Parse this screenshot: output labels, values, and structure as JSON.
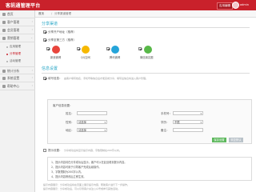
{
  "header": {
    "brand": "客訊通管理平台",
    "button_label": "应用编辑",
    "user_name": "admin",
    "accent": "#c9212b"
  },
  "sidebar": {
    "items": [
      {
        "label": "首页",
        "icon": "home-icon"
      },
      {
        "label": "客户管理",
        "icon": "users-icon"
      },
      {
        "label": "会员管理",
        "icon": "member-icon"
      },
      {
        "label": "营销管理",
        "icon": "marketing-icon"
      }
    ],
    "subitems": [
      {
        "label": "应用管理",
        "active": false
      },
      {
        "label": "分享管理",
        "active": true
      },
      {
        "label": "活动管理",
        "active": false
      }
    ],
    "items_bottom": [
      {
        "label": "统计分析",
        "icon": "chart-icon"
      },
      {
        "label": "系统设置",
        "icon": "settings-icon"
      },
      {
        "label": "帮助中心",
        "icon": "help-icon"
      }
    ]
  },
  "breadcrumb": {
    "home": "首页",
    "sep": "/",
    "current": "分享渠道管理"
  },
  "share_section": {
    "title": "分享渠道",
    "option1": "分享开户地址（推荐）",
    "option2": "分享至第三方（推荐）",
    "channels": [
      {
        "label": "新浪微博",
        "color": "#e8453c",
        "icon": "weibo-icon"
      },
      {
        "label": "QQ空间",
        "color": "#f6b800",
        "icon": "qzone-icon"
      },
      {
        "label": "腾讯微博",
        "color": "#25a4d9",
        "icon": "tencent-weibo-icon"
      },
      {
        "label": "微信朋友圈",
        "color": "#58b848",
        "icon": "wechat-icon"
      }
    ]
  },
  "info_section": {
    "title": "信息设置",
    "option1_label": "填写信息：",
    "option1_hint": "由客户填写姓名、手机号等信息后才能完成分享，填写后信息将进入客户管理。",
    "panel_title": "客户信息设置：",
    "fields": [
      {
        "label": "姓名：",
        "value": ""
      },
      {
        "label": "手机号：",
        "value": ""
      },
      {
        "label": "性别：",
        "value": "请选择"
      },
      {
        "label": "学历：",
        "value": "不限"
      },
      {
        "label": "地区：",
        "value": "请选择"
      },
      {
        "label": "备注：",
        "value": ""
      }
    ],
    "save_button": "保存设置",
    "reset_button": "恢复默认",
    "option2_label": "提示设置：",
    "option2_hint": "分享成功后将显示提示内容，字数限制在200字以内。",
    "notes": [
      "1、提示内容将在分享成功后显示，客户可以在此处看到提示内容。",
      "2、提示内容可用于引导客户完成后续操作。",
      "3、字数限制为200字以内。",
      "4、提示内容修改后立即生效。"
    ],
    "footer1": "提示内容展示：分享成功后将在页面上展示提示内容，帮助客户进行下一步操作。",
    "footer2": "提示内容展示：分享成功后，可以引导客户关注公众号或参与其他活动。"
  }
}
